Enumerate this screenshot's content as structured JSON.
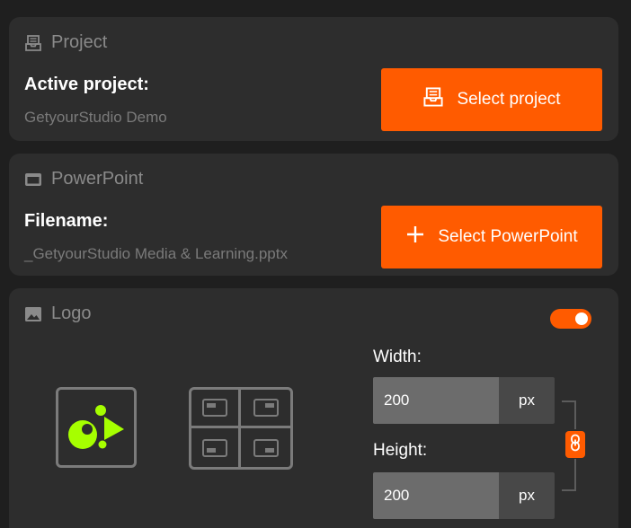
{
  "project": {
    "header_icon": "inbox-tray-icon",
    "header_label": "Project",
    "field_label": "Active project:",
    "field_value": "GetyourStudio Demo",
    "button_icon": "inbox-tray-icon",
    "button_label": "Select project"
  },
  "powerpoint": {
    "header_icon": "window-icon",
    "header_label": "PowerPoint",
    "field_label": "Filename:",
    "field_value": "_GetyourStudio Media & Learning.pptx",
    "button_icon": "plus-icon",
    "button_label": "Select PowerPoint"
  },
  "logo": {
    "header_icon": "image-icon",
    "header_label": "Logo",
    "enabled": true,
    "width_label": "Width:",
    "width_value": "200",
    "width_unit": "px",
    "height_label": "Height:",
    "height_value": "200",
    "height_unit": "px",
    "link_icon": "chain-link-icon",
    "position_options": [
      "top-left",
      "top-right",
      "bottom-left",
      "bottom-right"
    ]
  },
  "colors": {
    "accent": "#ff5b00",
    "panel": "#2d2d2d",
    "background": "#1f1f1f",
    "logo_mark": "#a6ff00"
  }
}
